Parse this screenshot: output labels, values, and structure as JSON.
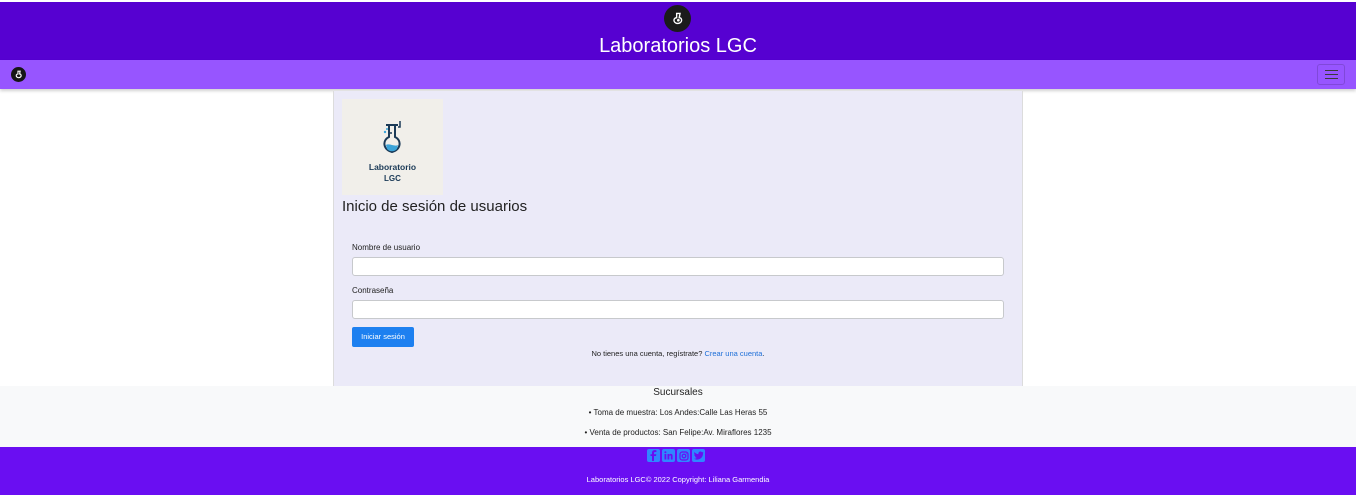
{
  "header": {
    "title": "Laboratorios LGC",
    "logo_icon": "flask-emblem-icon",
    "background_color": "#5601d1"
  },
  "navbar": {
    "brand_icon": "flask-emblem-icon",
    "toggler_icon": "hamburger-menu-icon",
    "background_color": "#9755ff"
  },
  "login": {
    "logo_text_line1": "Laboratorio",
    "logo_text_line2": "LGC",
    "heading": "Inicio de sesión de usuarios",
    "username_label": "Nombre de usuario",
    "username_value": "",
    "password_label": "Contraseña",
    "password_value": "",
    "submit_label": "Iniciar sesión",
    "register_prompt": "No tienes una cuenta, regístrate?",
    "register_link": "Crear una cuenta",
    "register_suffix": ".",
    "accent_color": "#1d80f0"
  },
  "branches": {
    "title": "Sucursales",
    "items": [
      "Toma de muestra: Los Andes:Calle Las Heras 55",
      "Venta de productos: San Felipe:Av. Miraflores 1235"
    ]
  },
  "footer": {
    "social_icons": [
      "facebook-icon",
      "linkedin-icon",
      "instagram-icon",
      "twitter-icon"
    ],
    "copyright": "Laboratorios LGC© 2022 Copyright: Liliana Garmendia",
    "background_color": "#6a0ef2"
  }
}
